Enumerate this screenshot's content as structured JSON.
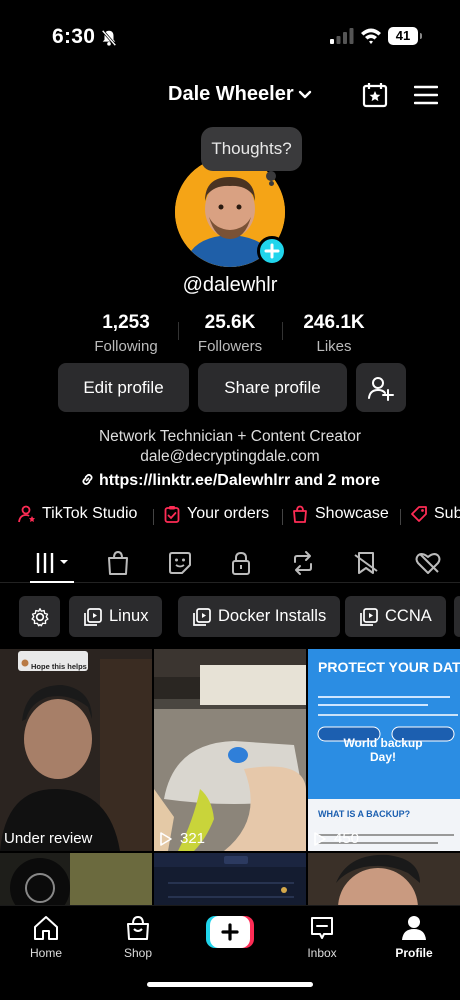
{
  "status": {
    "time": "6:30",
    "battery": "41"
  },
  "header": {
    "username": "Dale Wheeler"
  },
  "thoughts_bubble": "Thoughts?",
  "profile": {
    "handle": "@dalewhlr"
  },
  "stats": [
    {
      "value": "1,253",
      "label": "Following"
    },
    {
      "value": "25.6K",
      "label": "Followers"
    },
    {
      "value": "246.1K",
      "label": "Likes"
    }
  ],
  "actions": {
    "edit": "Edit profile",
    "share": "Share profile"
  },
  "bio": {
    "line1": "Network Technician + Content Creator",
    "line2": "dale@decryptingdale.com",
    "link": "https://linktr.ee/Dalewhlrr and 2 more"
  },
  "quicklinks": [
    "TikTok Studio",
    "Your orders",
    "Showcase",
    "Sub"
  ],
  "playlists": [
    "Linux",
    "Docker Installs",
    "CCNA"
  ],
  "videos": [
    {
      "label": "Under review",
      "overlay": "Hope this helps"
    },
    {
      "views": "321"
    },
    {
      "views": "450",
      "headline": "PROTECT YOUR DATA",
      "subline": "World backup Day!",
      "section": "WHAT IS A BACKUP?"
    }
  ],
  "tabbar": [
    "Home",
    "Shop",
    "Inbox",
    "Profile"
  ],
  "colors": {
    "accent_cyan": "#20d5ec",
    "accent_red": "#fe2c55",
    "avatar_bg": "#f5a416"
  }
}
